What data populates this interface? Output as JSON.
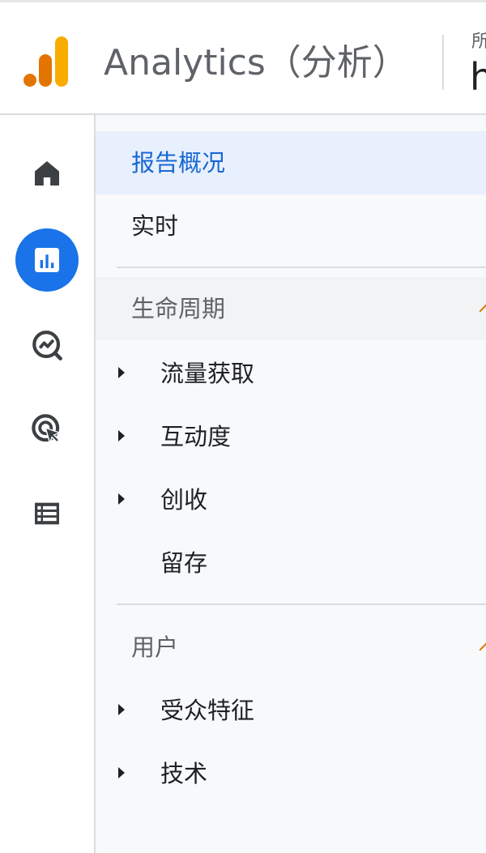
{
  "header": {
    "app_title": "Analytics（分析）",
    "account_label": "所",
    "account_name": "h",
    "logo_colors": [
      "#e37400",
      "#f9ab00"
    ]
  },
  "rail": {
    "items": [
      {
        "icon": "home-icon",
        "active": false
      },
      {
        "icon": "reports-icon",
        "active": true
      },
      {
        "icon": "explore-icon",
        "active": false
      },
      {
        "icon": "advertising-icon",
        "active": false
      },
      {
        "icon": "configure-icon",
        "active": false
      }
    ],
    "active_color": "#1a73e8"
  },
  "nav": {
    "overview": "报告概况",
    "realtime": "实时",
    "lifecycle": {
      "title": "生命周期",
      "items": [
        "流量获取",
        "互动度",
        "创收",
        "留存"
      ]
    },
    "user": {
      "title": "用户",
      "items": [
        "受众特征",
        "技术"
      ]
    },
    "selected_color": "#1967d2"
  }
}
